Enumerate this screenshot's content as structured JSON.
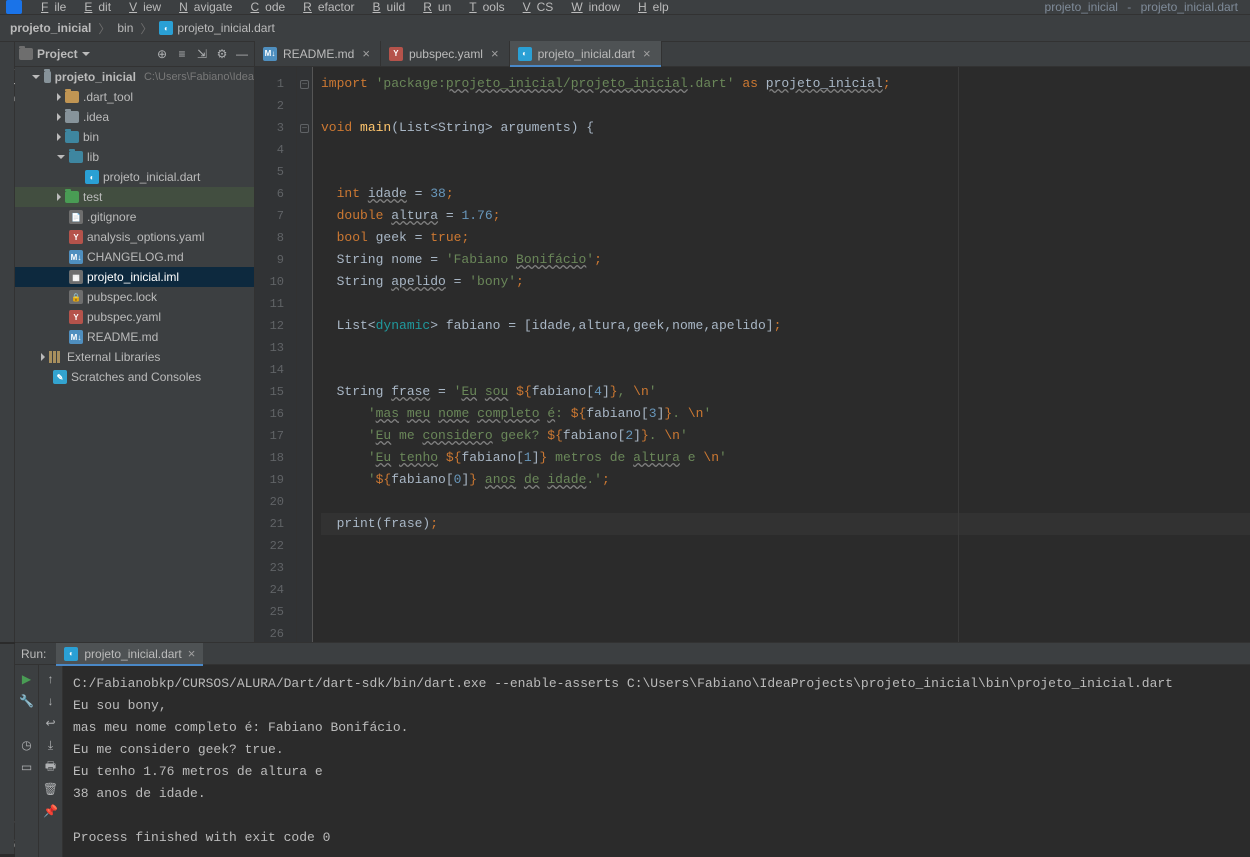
{
  "menubar": {
    "items": [
      "File",
      "Edit",
      "View",
      "Navigate",
      "Code",
      "Refactor",
      "Build",
      "Run",
      "Tools",
      "VCS",
      "Window",
      "Help"
    ],
    "context_project": "projeto_inicial",
    "context_file": "projeto_inicial.dart"
  },
  "breadcrumbs": {
    "root": "projeto_inicial",
    "folder": "bin",
    "file": "projeto_inicial.dart"
  },
  "project_panel": {
    "title": "Project",
    "root_name": "projeto_inicial",
    "root_path": "C:\\Users\\Fabiano\\Idea",
    "items": [
      {
        "indent": 1,
        "arrow": "down",
        "icon": "folder",
        "name": "projeto_inicial",
        "path": "C:\\Users\\Fabiano\\Idea"
      },
      {
        "indent": 2,
        "arrow": "right",
        "icon": "folder-orange",
        "name": ".dart_tool"
      },
      {
        "indent": 2,
        "arrow": "right",
        "icon": "folder",
        "name": ".idea"
      },
      {
        "indent": 2,
        "arrow": "right",
        "icon": "folder-src",
        "name": "bin"
      },
      {
        "indent": 2,
        "arrow": "down",
        "icon": "folder-src",
        "name": "lib"
      },
      {
        "indent": 3,
        "arrow": "",
        "icon": "dart",
        "name": "projeto_inicial.dart"
      },
      {
        "indent": 2,
        "arrow": "right",
        "icon": "folder-test",
        "name": "test",
        "hl": "test"
      },
      {
        "indent": 2,
        "arrow": "",
        "icon": "file",
        "name": ".gitignore"
      },
      {
        "indent": 2,
        "arrow": "",
        "icon": "yaml",
        "name": "analysis_options.yaml"
      },
      {
        "indent": 2,
        "arrow": "",
        "icon": "md",
        "name": "CHANGELOG.md"
      },
      {
        "indent": 2,
        "arrow": "",
        "icon": "iml",
        "name": "projeto_inicial.iml",
        "selected": true
      },
      {
        "indent": 2,
        "arrow": "",
        "icon": "lock",
        "name": "pubspec.lock"
      },
      {
        "indent": 2,
        "arrow": "",
        "icon": "yaml",
        "name": "pubspec.yaml"
      },
      {
        "indent": 2,
        "arrow": "",
        "icon": "md",
        "name": "README.md"
      },
      {
        "indent": 1,
        "arrow": "right",
        "icon": "lib",
        "name": "External Libraries"
      },
      {
        "indent": 1,
        "arrow": "",
        "icon": "scratch",
        "name": "Scratches and Consoles"
      }
    ]
  },
  "editor": {
    "tabs": [
      {
        "icon": "md",
        "label": "README.md",
        "active": false
      },
      {
        "icon": "yaml",
        "label": "pubspec.yaml",
        "active": false
      },
      {
        "icon": "dart",
        "label": "projeto_inicial.dart",
        "active": true
      }
    ],
    "line_count": 26,
    "code_lines": [
      {
        "n": 1,
        "html": "<span class='kw'>import</span> <span class='str'>'package:<span class='under'>projeto_inicial</span>/<span class='under'>projeto_inicial</span>.dart'</span> <span class='kw'>as</span> <span class='under hlimp'>projeto_inicial</span><span class='sem'>;</span>"
      },
      {
        "n": 2,
        "html": ""
      },
      {
        "n": 3,
        "html": "<span class='kw'>void</span> <span class='fn'>main</span>(List&lt;String&gt; arguments) {"
      },
      {
        "n": 4,
        "html": ""
      },
      {
        "n": 5,
        "html": ""
      },
      {
        "n": 6,
        "html": "  <span class='kw'>int</span> <span class='under'>idade</span> = <span class='num'>38</span><span class='sem'>;</span>"
      },
      {
        "n": 7,
        "html": "  <span class='kw'>double</span> <span class='under'>altura</span> = <span class='num'>1.76</span><span class='sem'>;</span>"
      },
      {
        "n": 8,
        "html": "  <span class='kw'>bool</span> geek = <span class='kw'>true</span><span class='sem'>;</span>"
      },
      {
        "n": 9,
        "html": "  String nome = <span class='str'>'Fabiano <span class='under'>Bonifácio</span>'</span><span class='sem'>;</span>"
      },
      {
        "n": 10,
        "html": "  String <span class='under'>apelido</span> = <span class='str'>'bony'</span><span class='sem'>;</span>"
      },
      {
        "n": 11,
        "html": ""
      },
      {
        "n": 12,
        "html": "  List&lt;<span class='dyn'>dynamic</span>&gt; <span class='var'>fabiano</span> = [<span class='var'>idade</span>,<span class='var'>altura</span>,<span class='var'>geek</span>,<span class='var'>nome</span>,<span class='var'>apelido</span>]<span class='sem'>;</span>"
      },
      {
        "n": 13,
        "html": ""
      },
      {
        "n": 14,
        "html": ""
      },
      {
        "n": 15,
        "html": "  String <span class='under'>frase</span> = <span class='str'>'<span class='under'>Eu</span> <span class='under'>sou</span> </span><span class='kw'>${</span>fabiano[<span class='num'>4</span>]<span class='kw'>}</span><span class='str'>, <span class='esc'>\\n</span>'</span>"
      },
      {
        "n": 16,
        "html": "      <span class='str'>'<span class='under'>mas</span> <span class='under'>meu</span> <span class='under'>nome</span> <span class='under'>completo</span> <span class='under'>é</span>: </span><span class='kw'>${</span>fabiano[<span class='num'>3</span>]<span class='kw'>}</span><span class='str'>. <span class='esc'>\\n</span>'</span>"
      },
      {
        "n": 17,
        "html": "      <span class='str'>'<span class='under'>Eu</span> me <span class='under'>considero</span> geek? </span><span class='kw'>${</span>fabiano[<span class='num'>2</span>]<span class='kw'>}</span><span class='str'>. <span class='esc'>\\n</span>'</span>"
      },
      {
        "n": 18,
        "html": "      <span class='str'>'<span class='under'>Eu</span> <span class='under'>tenho</span> </span><span class='kw'>${</span>fabiano[<span class='num'>1</span>]<span class='kw'>}</span><span class='str'> metros de <span class='under'>altura</span> e <span class='esc'>\\n</span>'</span>"
      },
      {
        "n": 19,
        "html": "      <span class='str'>'</span><span class='kw'>${</span>fabiano[<span class='num'>0</span>]<span class='kw'>}</span><span class='str'> <span class='under'>anos</span> <span class='under'>de</span> <span class='under'>idade</span>.'</span><span class='sem'>;</span>"
      },
      {
        "n": 20,
        "html": ""
      },
      {
        "n": 21,
        "html": "  print(frase)<span class='sem'>;</span>",
        "current": true
      },
      {
        "n": 22,
        "html": ""
      },
      {
        "n": 23,
        "html": ""
      },
      {
        "n": 24,
        "html": ""
      },
      {
        "n": 25,
        "html": ""
      },
      {
        "n": 26,
        "html": ""
      }
    ]
  },
  "run": {
    "title": "Run:",
    "tab": "projeto_inicial.dart",
    "output": "C:/Fabianobkp/CURSOS/ALURA/Dart/dart-sdk/bin/dart.exe --enable-asserts C:\\Users\\Fabiano\\IdeaProjects\\projeto_inicial\\bin\\projeto_inicial.dart\nEu sou bony,\nmas meu nome completo é: Fabiano Bonifácio.\nEu me considero geek? true.\nEu tenho 1.76 metros de altura e\n38 anos de idade.\n\nProcess finished with exit code 0"
  },
  "sidetab_top": "Project",
  "sidetab_bottom": "Structure"
}
